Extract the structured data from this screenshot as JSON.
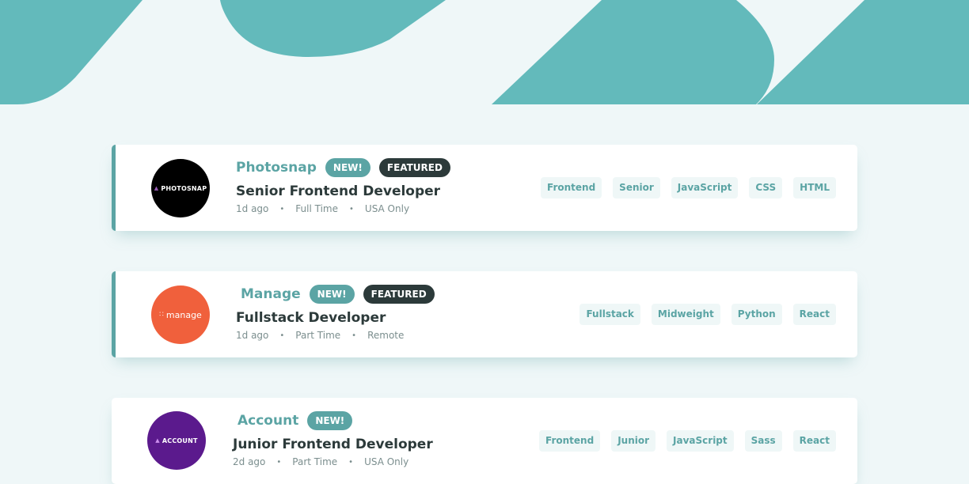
{
  "colors": {
    "primary": "#5ba4a4",
    "background": "#eff7f8",
    "dark": "#2c3a3a",
    "muted": "#7b8e8e",
    "tag_bg": "#eff7f7"
  },
  "jobs": [
    {
      "company": "Photosnap",
      "logo_text": "PHOTOSNAP",
      "logo_color": "#000000",
      "new": true,
      "new_label": "NEW!",
      "featured": true,
      "featured_label": "FEATURED",
      "position": "Senior Frontend Developer",
      "posted": "1d ago",
      "contract": "Full Time",
      "location": "USA Only",
      "tags": [
        "Frontend",
        "Senior",
        "JavaScript",
        "CSS",
        "HTML"
      ]
    },
    {
      "company": "Manage",
      "logo_text": "manage",
      "logo_color": "#f0603c",
      "new": true,
      "new_label": "NEW!",
      "featured": true,
      "featured_label": "FEATURED",
      "position": "Fullstack Developer",
      "posted": "1d ago",
      "contract": "Part Time",
      "location": "Remote",
      "tags": [
        "Fullstack",
        "Midweight",
        "Python",
        "React"
      ]
    },
    {
      "company": "Account",
      "logo_text": "ACCOUNT",
      "logo_color": "#5b1a8d",
      "new": true,
      "new_label": "NEW!",
      "featured": false,
      "position": "Junior Frontend Developer",
      "posted": "2d ago",
      "contract": "Part Time",
      "location": "USA Only",
      "tags": [
        "Frontend",
        "Junior",
        "JavaScript",
        "Sass",
        "React"
      ]
    }
  ]
}
